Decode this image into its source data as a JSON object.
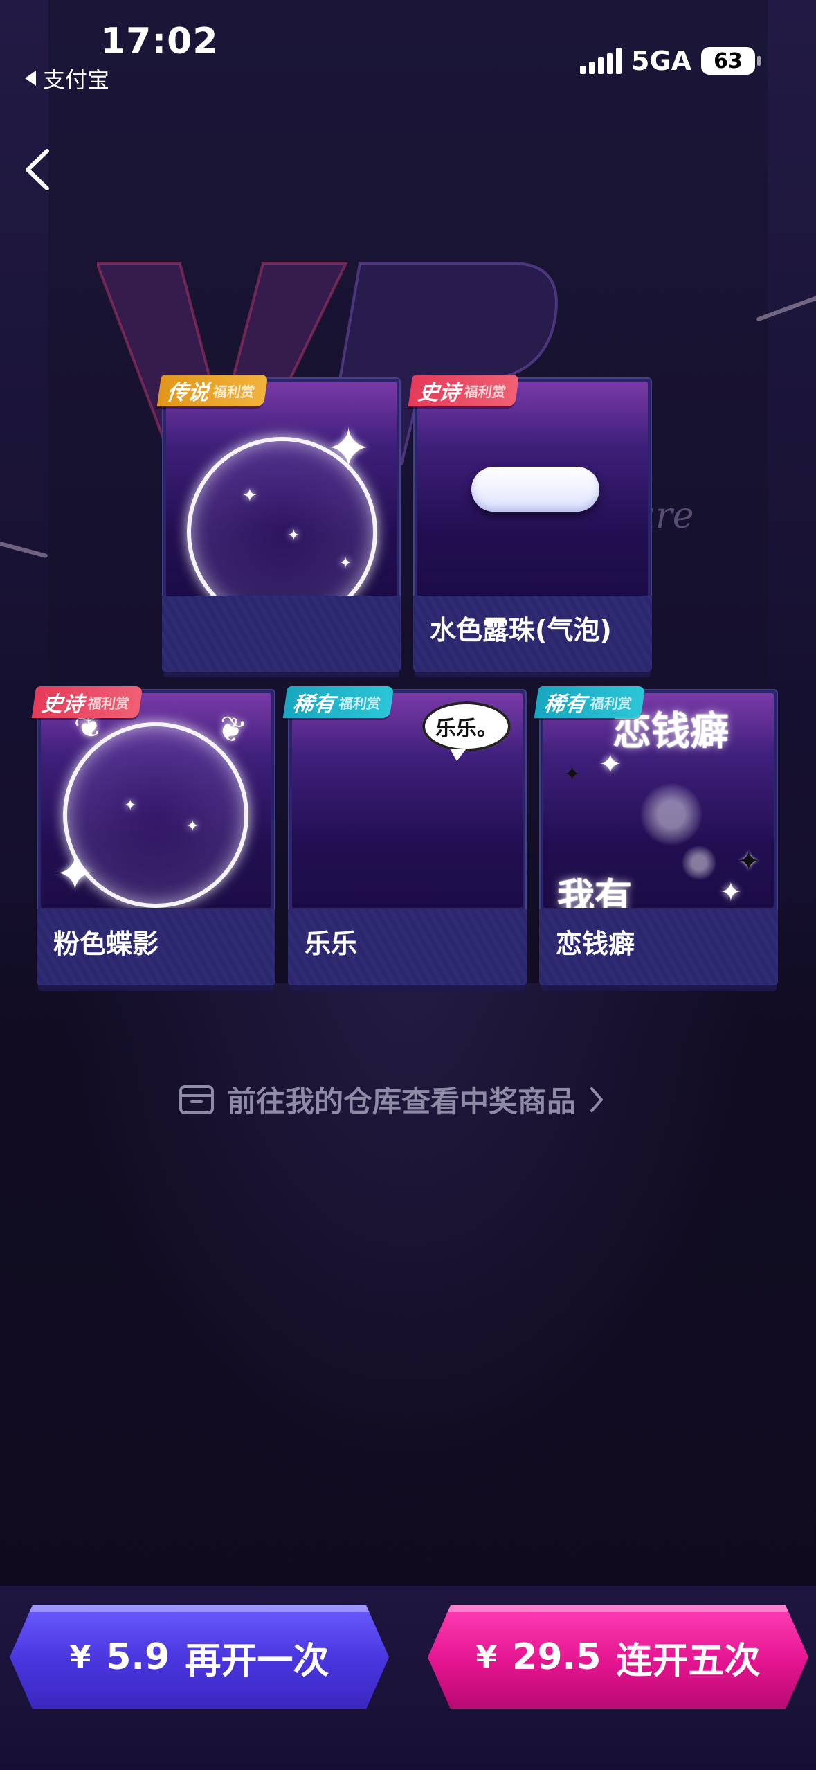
{
  "status_bar": {
    "time": "17:02",
    "back_app": "支付宝",
    "network": "5GA",
    "battery": "63"
  },
  "background": {
    "welfare_text": "lfare"
  },
  "cards": [
    {
      "badge": "传说",
      "badge_sub": "福利赏",
      "badge_type": "legend",
      "label": ""
    },
    {
      "badge": "史诗",
      "badge_sub": "福利赏",
      "badge_type": "epic",
      "label": "水色露珠(气泡)"
    },
    {
      "badge": "史诗",
      "badge_sub": "福利赏",
      "badge_type": "epic",
      "label": "粉色蝶影"
    },
    {
      "badge": "稀有",
      "badge_sub": "福利赏",
      "badge_type": "rare",
      "label": "乐乐",
      "bubble_text": "乐乐。"
    },
    {
      "badge": "稀有",
      "badge_sub": "福利赏",
      "badge_type": "rare",
      "label": "恋钱癖",
      "deco_top": "恋钱癖",
      "deco_bottom": "我有"
    }
  ],
  "warehouse_link": "前往我的仓库查看中奖商品",
  "buttons": {
    "once": {
      "currency": "¥",
      "price": "5.9",
      "label": "再开一次"
    },
    "five": {
      "currency": "¥",
      "price": "29.5",
      "label": "连开五次"
    }
  },
  "colors": {
    "legend": "#e1961a",
    "epic": "#e53b5a",
    "rare": "#18a6c0",
    "button_once": "#4a37e0",
    "button_five": "#e4148f"
  }
}
